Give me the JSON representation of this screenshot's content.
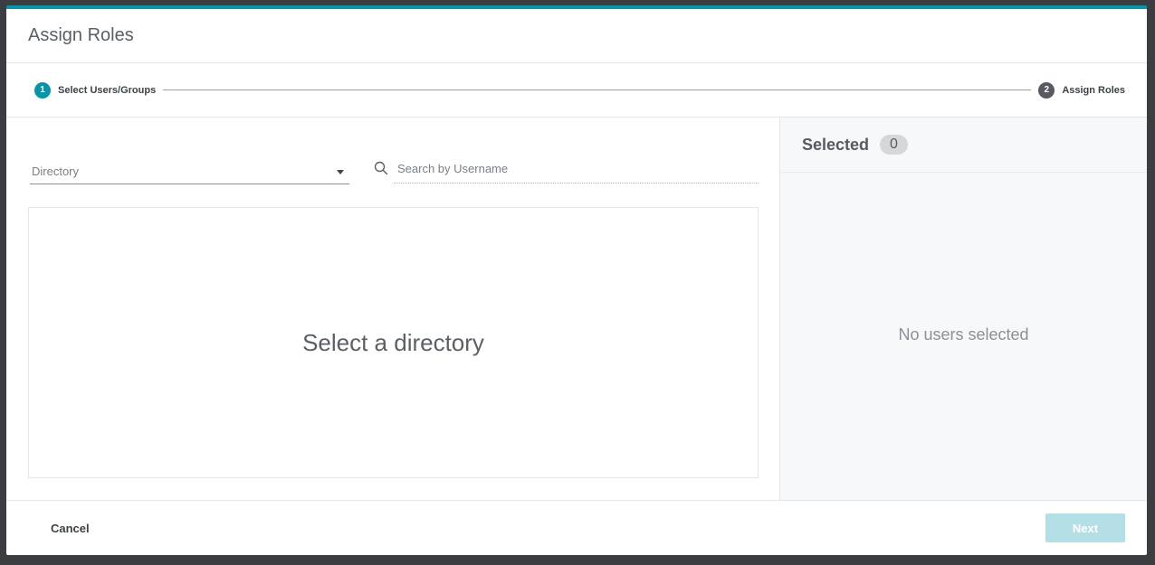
{
  "modal": {
    "title": "Assign Roles"
  },
  "stepper": {
    "steps": [
      {
        "number": "1",
        "label": "Select Users/Groups"
      },
      {
        "number": "2",
        "label": "Assign Roles"
      }
    ]
  },
  "filters": {
    "directory_label": "Directory",
    "search_placeholder": "Search by Username"
  },
  "results": {
    "empty_message": "Select a directory"
  },
  "selected": {
    "title": "Selected",
    "count": "0",
    "empty_message": "No users selected"
  },
  "footer": {
    "cancel_label": "Cancel",
    "next_label": "Next"
  },
  "colors": {
    "accent": "#0a94a8",
    "next_disabled": "#b3e0e6"
  }
}
